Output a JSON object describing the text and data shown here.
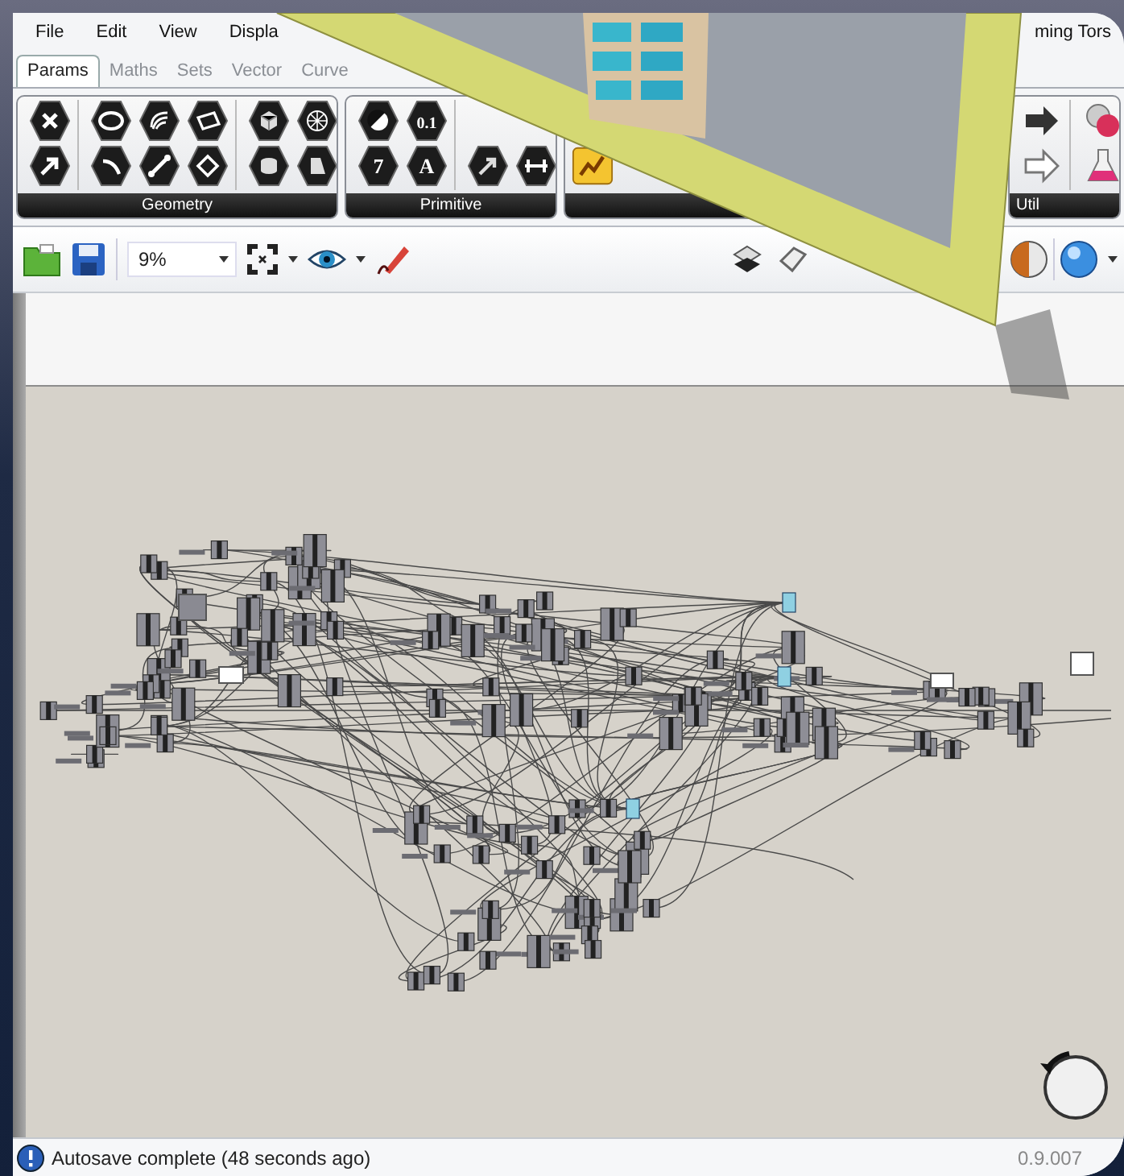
{
  "menu": [
    "File",
    "Edit",
    "View",
    "Displa"
  ],
  "window": {
    "title": "ming Tors"
  },
  "tabs": [
    {
      "label": "Params",
      "selected": true
    },
    {
      "label": "Maths",
      "selected": false
    },
    {
      "label": "Sets",
      "selected": false
    },
    {
      "label": "Vector",
      "selected": false
    },
    {
      "label": "Curve",
      "selected": false
    }
  ],
  "ribbon": {
    "groups": [
      {
        "label": "Geometry"
      },
      {
        "label": "Primitive",
        "icon_labels": [
          "0.1",
          "7",
          "A"
        ]
      },
      {
        "label": "Util"
      }
    ]
  },
  "toolbar": {
    "zoom": {
      "value": "9%"
    }
  },
  "status_bar": {
    "message": "Autosave complete (48 seconds ago)",
    "version": "0.9.007"
  }
}
